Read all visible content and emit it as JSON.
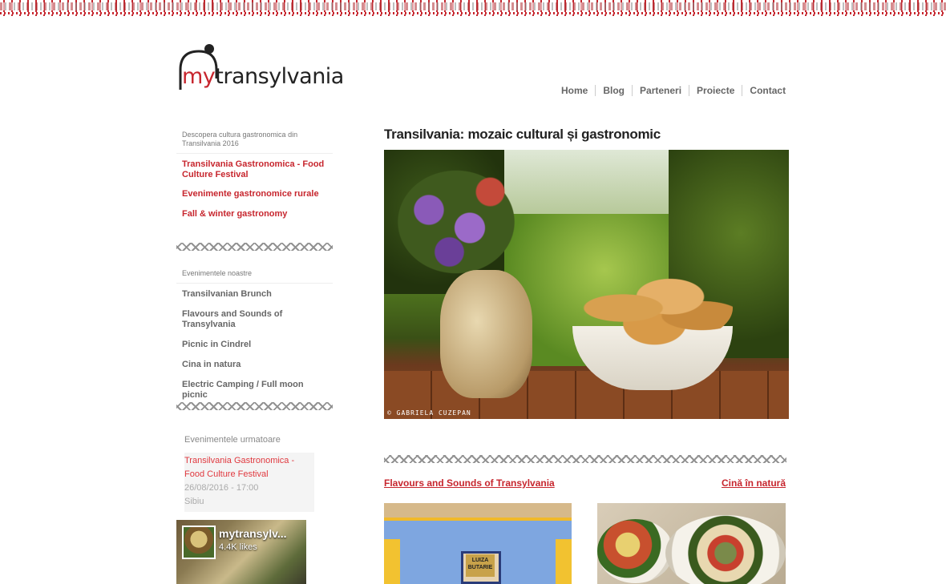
{
  "brand": {
    "logo_prefix": "my",
    "logo_suffix": "transylvania",
    "accent": "#c7262e"
  },
  "nav": {
    "items": [
      "Home",
      "Blog",
      "Parteneri",
      "Proiecte",
      "Contact"
    ]
  },
  "sidebar": {
    "intro_heading": "Descopera cultura gastronomica din Transilvania 2016",
    "intro_links": [
      "Transilvania Gastronomica - Food Culture Festival",
      "Evenimente gastronomice rurale",
      "Fall & winter gastronomy"
    ],
    "events_heading": "Evenimentele noastre",
    "events_links": [
      "Transilvanian Brunch",
      "Flavours and Sounds of Transylvania",
      "Picnic in Cindrel",
      "Cina in natura",
      "Electric Camping / Full moon picnic"
    ],
    "upcoming": {
      "title": "Evenimentele urmatoare",
      "event_name": "Transilvania Gastronomica - Food Culture Festival",
      "event_date": "26/08/2016 - 17:00",
      "event_place": "Sibiu"
    },
    "facebook": {
      "name": "mytransylv...",
      "likes": "4.4K likes"
    }
  },
  "main": {
    "title": "Transilvania: mozaic cultural și gastronomic",
    "hero_caption": "© GABRIELA CUZEPAN",
    "card_left_title": "Flavours and Sounds of Transylvania",
    "card_right_title": "Cină în natură",
    "sign_text": "LUIZA BUTARIE"
  }
}
